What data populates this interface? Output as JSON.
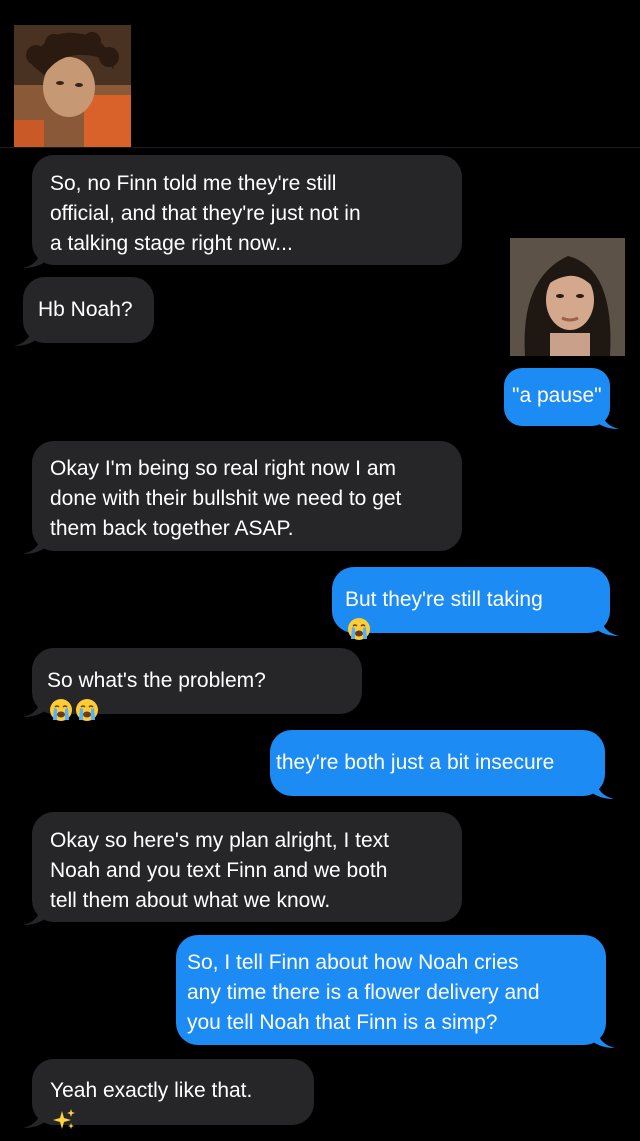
{
  "colors": {
    "background": "#000000",
    "incoming_bubble": "#262628",
    "outgoing_bubble": "#1d8bf4",
    "text": "#ffffff"
  },
  "contacts": {
    "left_avatar": "profile-photo-curly-haired-person",
    "right_avatar": "profile-photo-dark-haired-person"
  },
  "messages": [
    {
      "side": "incoming",
      "text": "So, no Finn told me they're still\nofficial, and that they're just not in\na talking stage right now..."
    },
    {
      "side": "incoming",
      "text": "Hb Noah?"
    },
    {
      "side": "outgoing",
      "text": "\"a pause\""
    },
    {
      "side": "incoming",
      "text": "Okay I'm being so real right now I am\ndone with their bullshit we need to get\nthem back together ASAP."
    },
    {
      "side": "outgoing",
      "text": "But they're still taking",
      "emoji": [
        "crying-face-emoji"
      ]
    },
    {
      "side": "incoming",
      "text": "So what's the problem?",
      "emoji": [
        "crying-face-emoji",
        "crying-face-emoji"
      ]
    },
    {
      "side": "outgoing",
      "text": "they're both just a bit insecure"
    },
    {
      "side": "incoming",
      "text": "Okay so here's my plan alright, I text\nNoah and you text Finn and we both\ntell them about what we know."
    },
    {
      "side": "outgoing",
      "text": "So, I tell Finn about how Noah cries\nany time there is a flower delivery and\nyou tell Noah that Finn is a simp?"
    },
    {
      "side": "incoming",
      "text": "Yeah exactly like that.",
      "emoji": [
        "sparkles-emoji"
      ]
    }
  ]
}
